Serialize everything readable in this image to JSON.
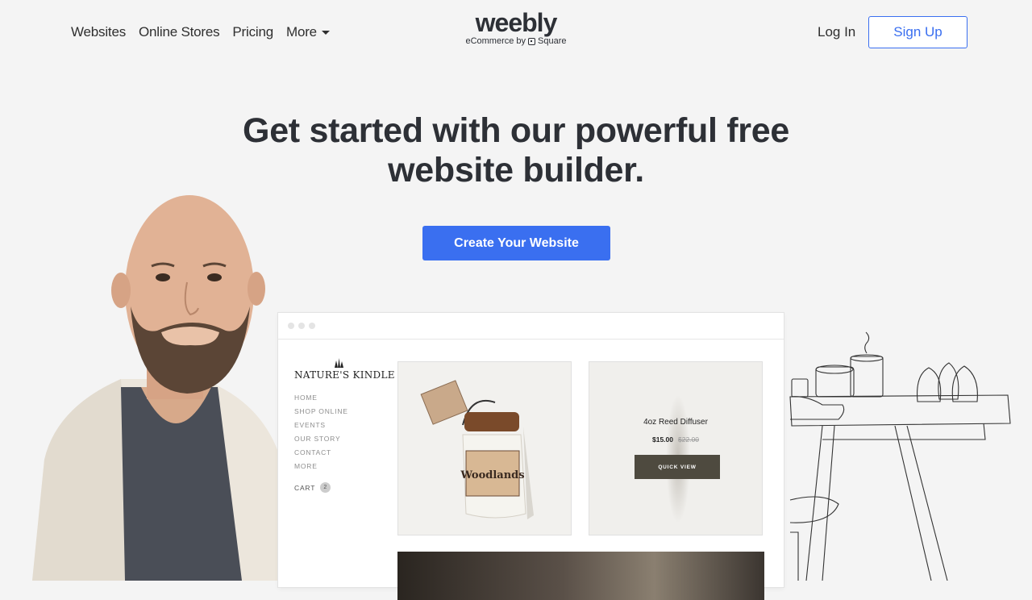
{
  "nav": {
    "links": [
      "Websites",
      "Online Stores",
      "Pricing"
    ],
    "more_label": "More",
    "logo_word": "weebly",
    "logo_sub_prefix": "eCommerce by",
    "logo_sub_brand": "Square",
    "login_label": "Log In",
    "signup_label": "Sign Up"
  },
  "hero": {
    "title_line1": "Get started with our powerful free",
    "title_line2": "website builder.",
    "cta_label": "Create Your Website"
  },
  "mockup": {
    "brand_name": "NATURE'S KINDLE",
    "menu": [
      "HOME",
      "SHOP ONLINE",
      "EVENTS",
      "OUR STORY",
      "CONTACT",
      "MORE"
    ],
    "cart_label": "CART",
    "cart_count": "2",
    "candle_label": "Woodlands",
    "product2": {
      "name": "4oz Reed Diffuser",
      "price": "$15.00",
      "old_price": "$22.00",
      "button": "QUICK VIEW"
    }
  },
  "colors": {
    "accent": "#3a6ff0",
    "background": "#f4f4f4",
    "heading": "#2d3036",
    "quick_view_bg": "#4e4a3f"
  }
}
